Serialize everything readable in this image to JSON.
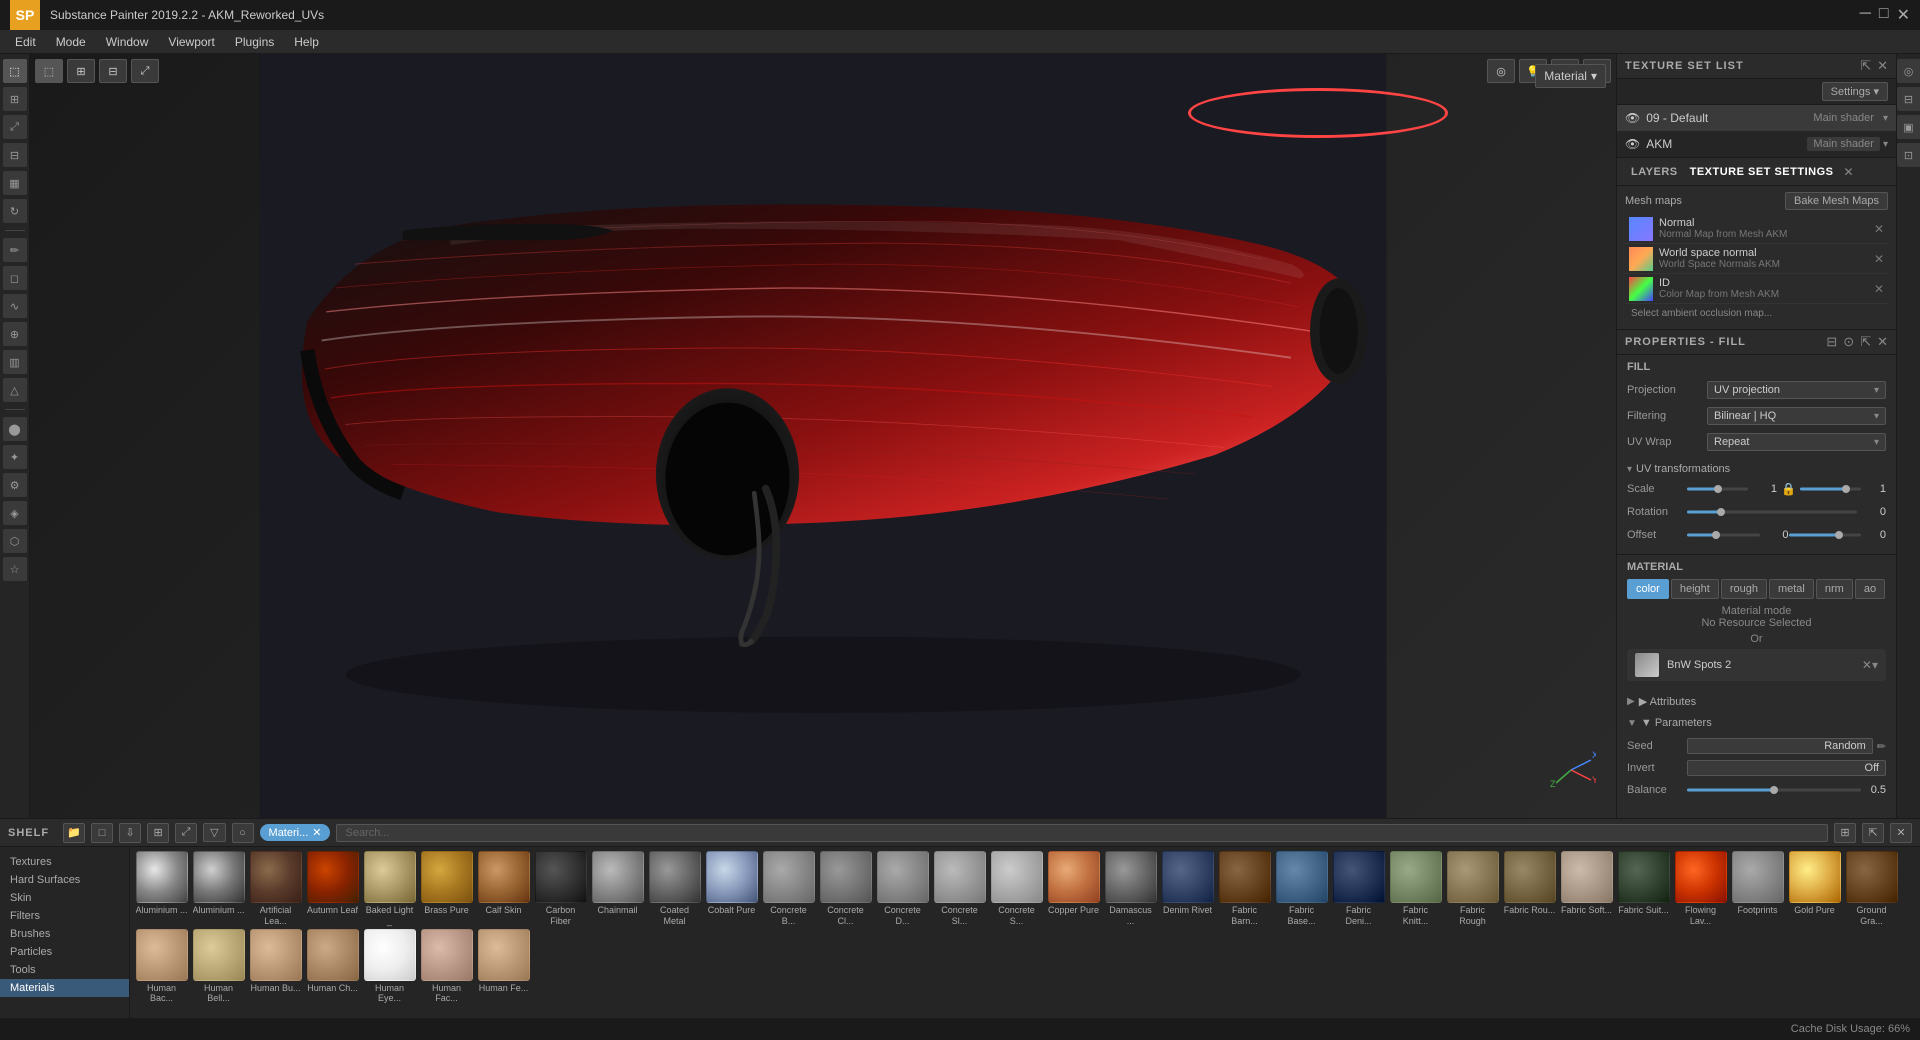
{
  "titleBar": {
    "title": "Substance Painter 2019.2.2 - AKM_Reworked_UVs",
    "logo": "SP"
  },
  "menuBar": {
    "items": [
      "Edit",
      "Mode",
      "Window",
      "Viewport",
      "Plugins",
      "Help"
    ]
  },
  "viewport": {
    "materialDropdown": "Material",
    "materialDropdownArrow": "▾"
  },
  "textureSetList": {
    "title": "TEXTURE SET LIST",
    "settingsBtn": "Settings ▾",
    "sets": [
      {
        "id": "ts-default",
        "name": "09 - Default",
        "shader": "Main shader"
      },
      {
        "id": "ts-akm",
        "name": "AKM",
        "shader": "Main shader"
      }
    ]
  },
  "layers": {
    "tab1": "LAYERS",
    "tab2": "TEXTURE SET SETTINGS",
    "meshMapsLabel": "Mesh maps",
    "bakeMeshMapsBtn": "Bake Mesh Maps",
    "meshMaps": [
      {
        "id": "mm-normal",
        "name": "Normal",
        "sub": "Normal Map from Mesh AKM",
        "thumbClass": "thumb-normal"
      },
      {
        "id": "mm-world",
        "name": "World space normal",
        "sub": "World Space Normals AKM",
        "thumbClass": "thumb-world"
      },
      {
        "id": "mm-id",
        "name": "ID",
        "sub": "Color Map from Mesh AKM",
        "thumbClass": "thumb-id"
      }
    ],
    "ambientOccText": "Select ambient occlusion map..."
  },
  "propertiesFill": {
    "title": "PROPERTIES - FILL",
    "fillTitle": "FILL",
    "projection": {
      "label": "Projection",
      "value": "UV projection"
    },
    "filtering": {
      "label": "Filtering",
      "value": "Bilinear | HQ"
    },
    "uvWrap": {
      "label": "UV Wrap",
      "value": "Repeat"
    },
    "uvTransformations": {
      "title": "UV transformations",
      "scale": {
        "label": "Scale",
        "value1": "1",
        "thumbPos1": 50,
        "thumbPos2": 75
      },
      "rotation": {
        "label": "Rotation",
        "value": "0",
        "thumbPos": 20
      },
      "offset": {
        "label": "Offset",
        "value1": "0",
        "value2": "0",
        "thumbPos1": 40,
        "thumbPos2": 70
      }
    }
  },
  "material": {
    "sectionTitle": "MATERIAL",
    "tabs": [
      "color",
      "height",
      "rough",
      "metal",
      "nrm",
      "ao"
    ],
    "activeTab": "color",
    "modeLabel": "Material mode",
    "noResource": "No Resource Selected",
    "orText": "Or",
    "baseColor": {
      "name": "BnW Spots 2"
    },
    "attributesLabel": "▶ Attributes",
    "parametersLabel": "▼ Parameters",
    "params": [
      {
        "label": "Seed",
        "value": "Random",
        "hasEdit": true
      },
      {
        "label": "Invert",
        "value": "Off"
      },
      {
        "label": "Balance",
        "value": "0.5"
      }
    ]
  },
  "shelf": {
    "title": "SHELF",
    "categories": [
      "Textures",
      "Hard Surfaces",
      "Skin",
      "Filters",
      "Brushes",
      "Particles",
      "Tools",
      "Materials"
    ],
    "activeCategory": "Materials",
    "searchPlaceholder": "Search...",
    "filterTag": "Materi...",
    "items": [
      {
        "id": "aluminium1",
        "label": "Aluminium ...",
        "cls": "mat-aluminium1"
      },
      {
        "id": "aluminium2",
        "label": "Aluminium ...",
        "cls": "mat-aluminium2"
      },
      {
        "id": "artificial",
        "label": "Artificial Lea...",
        "cls": "mat-artificial"
      },
      {
        "id": "autumn",
        "label": "Autumn Leaf",
        "cls": "mat-autumn"
      },
      {
        "id": "baked",
        "label": "Baked Light _",
        "cls": "mat-baked"
      },
      {
        "id": "brass",
        "label": "Brass Pure",
        "cls": "mat-brass"
      },
      {
        "id": "calf",
        "label": "Calf Skin",
        "cls": "mat-calf"
      },
      {
        "id": "carbon",
        "label": "Carbon Fiber",
        "cls": "mat-carbon"
      },
      {
        "id": "chainmail",
        "label": "Chainmail",
        "cls": "mat-chainmail"
      },
      {
        "id": "coated",
        "label": "Coated Metal",
        "cls": "mat-coated"
      },
      {
        "id": "cobalt",
        "label": "Cobalt Pure",
        "cls": "mat-cobalt"
      },
      {
        "id": "concreteb",
        "label": "Concrete B...",
        "cls": "mat-concrete-b"
      },
      {
        "id": "concretecl",
        "label": "Concrete Cl...",
        "cls": "mat-concrete-c"
      },
      {
        "id": "concreted",
        "label": "Concrete D...",
        "cls": "mat-concrete-d"
      },
      {
        "id": "concreteSl",
        "label": "Concrete Sl...",
        "cls": "mat-concrete-sl"
      },
      {
        "id": "concreteS",
        "label": "Concrete S...",
        "cls": "mat-concrete-s"
      },
      {
        "id": "copper",
        "label": "Copper Pure",
        "cls": "mat-copper"
      },
      {
        "id": "damascus",
        "label": "Damascus ...",
        "cls": "mat-damascus"
      },
      {
        "id": "denim",
        "label": "Denim Rivet",
        "cls": "mat-denim"
      },
      {
        "id": "fabricBarn",
        "label": "Fabric Barn...",
        "cls": "mat-fabric-barn"
      },
      {
        "id": "fabricBase",
        "label": "Fabric Base...",
        "cls": "mat-fabric-base"
      },
      {
        "id": "fabricDeni",
        "label": "Fabric Deni...",
        "cls": "mat-fabric-deni"
      },
      {
        "id": "fabricKnit",
        "label": "Fabric Knitt...",
        "cls": "mat-fabric-knit"
      },
      {
        "id": "fabricRough",
        "label": "Fabric Rough",
        "cls": "mat-fabric-rough"
      },
      {
        "id": "fabricRou2",
        "label": "Fabric Rou...",
        "cls": "mat-fabric-rou2"
      },
      {
        "id": "fabricSoft",
        "label": "Fabric Soft...",
        "cls": "mat-fabric-soft"
      },
      {
        "id": "fabricSuit",
        "label": "Fabric Suit...",
        "cls": "mat-fabric-suit"
      },
      {
        "id": "flowing",
        "label": "Flowing Lav...",
        "cls": "mat-flowing"
      },
      {
        "id": "footprints",
        "label": "Footprints",
        "cls": "mat-footprints"
      },
      {
        "id": "gold",
        "label": "Gold Pure",
        "cls": "mat-gold"
      },
      {
        "id": "ground",
        "label": "Ground Gra...",
        "cls": "mat-ground"
      },
      {
        "id": "humanBac",
        "label": "Human Bac...",
        "cls": "mat-human-bac"
      },
      {
        "id": "humanBel",
        "label": "Human Bell...",
        "cls": "mat-human-bel"
      },
      {
        "id": "humanBu",
        "label": "Human Bu...",
        "cls": "mat-human-bu"
      },
      {
        "id": "humanCh",
        "label": "Human Ch...",
        "cls": "mat-human-ch"
      },
      {
        "id": "humanEye",
        "label": "Human Eye...",
        "cls": "mat-human-eye"
      },
      {
        "id": "humanFac",
        "label": "Human Fac...",
        "cls": "mat-human-fac"
      },
      {
        "id": "humanFe",
        "label": "Human Fe...",
        "cls": "mat-human-fe"
      }
    ]
  },
  "statusBar": {
    "cacheText": "Cache Disk Usage: 66%"
  },
  "axisIndicator": {
    "x": "X",
    "y": "Y",
    "z": "Z"
  }
}
